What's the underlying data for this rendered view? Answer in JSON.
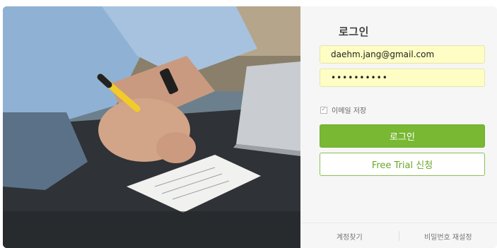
{
  "photo": {
    "alt": "person writing on notepad",
    "icon": "hand-writing-photo"
  },
  "login": {
    "title": "로그인",
    "email_value": "daehm.jang@gmail.com",
    "password_value": "••••••••••",
    "remember_label": "이메일 저장",
    "remember_checked": true,
    "login_button": "로그인",
    "trial_button": "Free Trial 신청"
  },
  "footer": {
    "find_account": "계정찾기",
    "reset_password": "비밀번호 재설정"
  },
  "colors": {
    "primary": "#78b833",
    "input_bg": "#fdfdc4",
    "panel_bg": "#f6f6f6"
  }
}
